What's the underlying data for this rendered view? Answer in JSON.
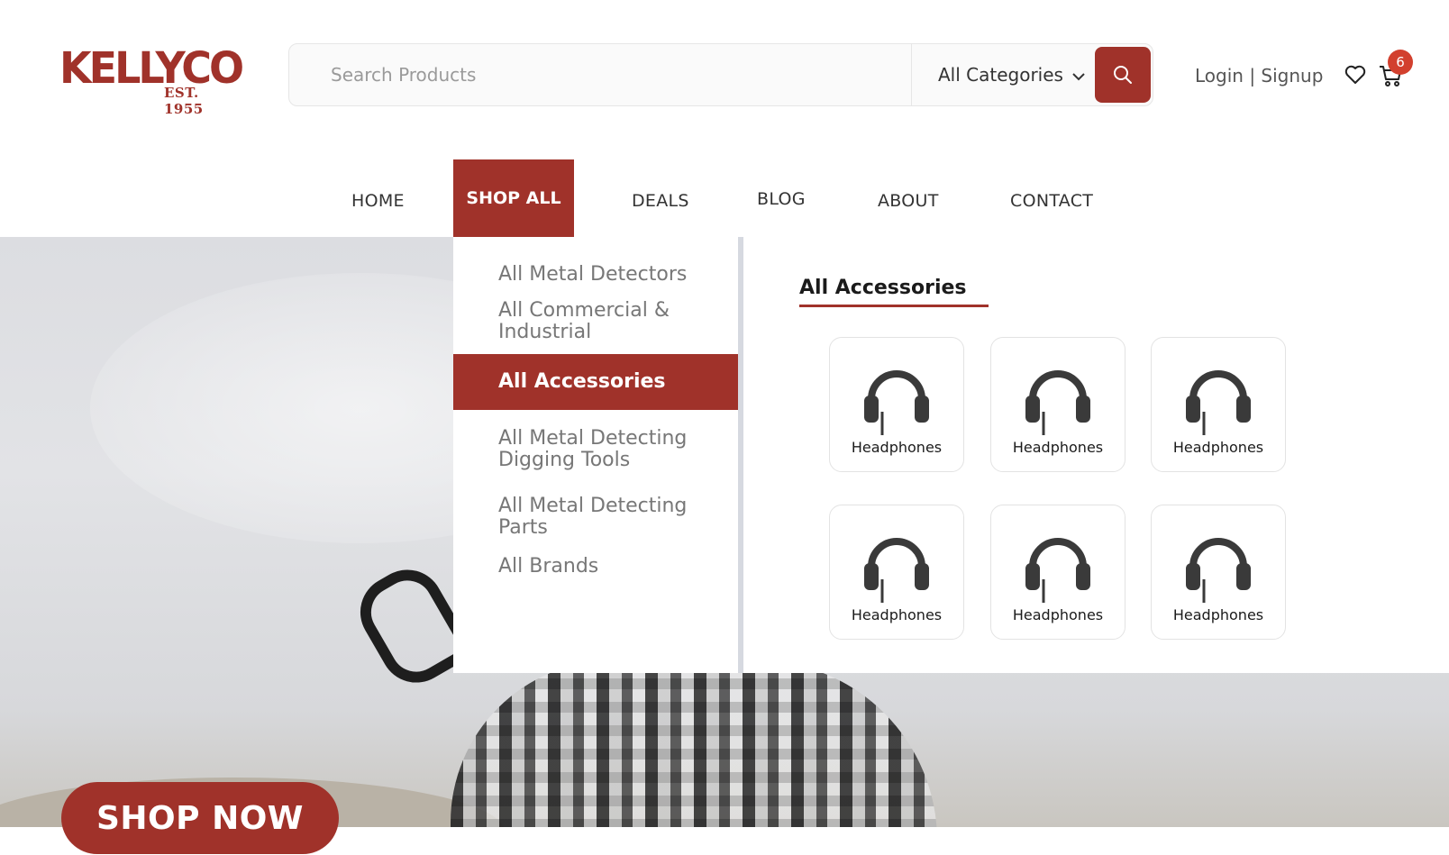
{
  "brand": {
    "name": "KELLYCO",
    "established": "EST. 1955",
    "color": "#a0322a"
  },
  "search": {
    "placeholder": "Search Products",
    "category": "All Categories"
  },
  "account": {
    "login_label": "Login | Signup",
    "cart_count": "6"
  },
  "nav": {
    "items": [
      {
        "label": "HOME"
      },
      {
        "label": "SHOP ALL"
      },
      {
        "label": "DEALS"
      },
      {
        "label": "BLOG"
      },
      {
        "label": "ABOUT"
      },
      {
        "label": "CONTACT"
      }
    ]
  },
  "mega_menu": {
    "categories": [
      {
        "label": "All Metal Detectors"
      },
      {
        "label": "All Commercial & Industrial"
      },
      {
        "label": "All Accessories"
      },
      {
        "label": "All Metal Detecting Digging Tools"
      },
      {
        "label": "All Metal Detecting Parts"
      },
      {
        "label": "All Brands"
      }
    ],
    "panel_title": "All Accessories",
    "cards": [
      {
        "label": "Headphones",
        "icon": "headphones-icon"
      },
      {
        "label": "Headphones",
        "icon": "headphones-icon"
      },
      {
        "label": "Headphones",
        "icon": "headphones-icon"
      },
      {
        "label": "Headphones",
        "icon": "headphones-icon"
      },
      {
        "label": "Headphones",
        "icon": "headphones-icon"
      },
      {
        "label": "Headphones",
        "icon": "headphones-icon"
      }
    ]
  },
  "hero": {
    "cta_label": "SHOP NOW"
  }
}
